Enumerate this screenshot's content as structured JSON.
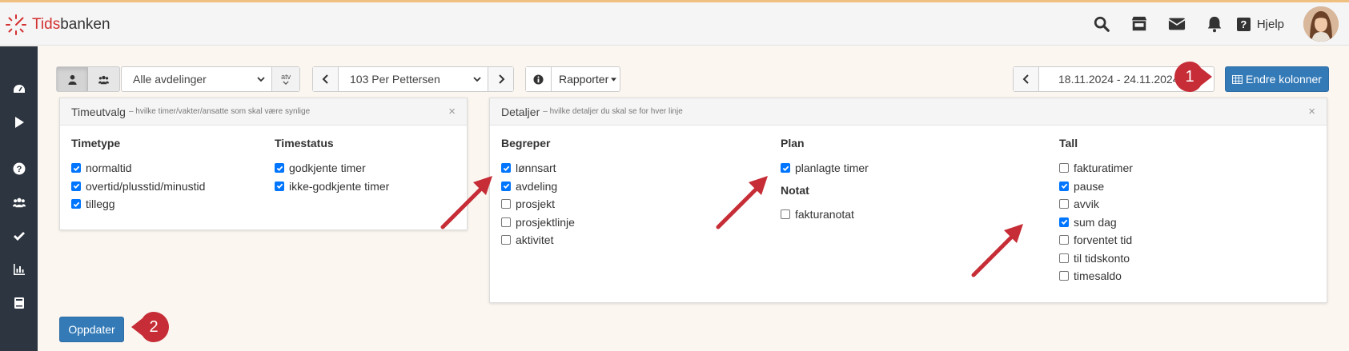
{
  "brand": {
    "logo_red": "Tids",
    "logo_dark": "banken"
  },
  "nav": {
    "icons": [
      "search-icon",
      "store-icon",
      "envelope-icon",
      "bell-icon"
    ],
    "help_label": "Hjelp"
  },
  "sidebar": {
    "icons": [
      "dashboard-icon",
      "play-icon",
      "question-icon",
      "users-icon",
      "check-icon",
      "bar-chart-icon",
      "book-icon"
    ]
  },
  "toolbar": {
    "department": "Alle avdelinger",
    "department_addon": "atv",
    "employee": "103 Per Pettersen",
    "reports_label": "Rapporter",
    "date_range": "18.11.2024 - 24.11.2024",
    "change_columns_label": "Endre kolonner"
  },
  "time_selection": {
    "title": "Timeutvalg",
    "subtitle": "– hvilke timer/vakter/ansatte som skal være synlige",
    "close": "×",
    "time_type": {
      "header": "Timetype",
      "items": [
        {
          "label": "normaltid",
          "checked": true
        },
        {
          "label": "overtid/plusstid/minustid",
          "checked": true
        },
        {
          "label": "tillegg",
          "checked": true
        }
      ]
    },
    "time_status": {
      "header": "Timestatus",
      "items": [
        {
          "label": "godkjente timer",
          "checked": true
        },
        {
          "label": "ikke-godkjente timer",
          "checked": true
        }
      ]
    }
  },
  "details": {
    "title": "Detaljer",
    "subtitle": "– hvilke detaljer du skal se for hver linje",
    "close": "×",
    "terms": {
      "header": "Begreper",
      "items": [
        {
          "label": "lønnsart",
          "checked": true
        },
        {
          "label": "avdeling",
          "checked": true
        },
        {
          "label": "prosjekt",
          "checked": false
        },
        {
          "label": "prosjektlinje",
          "checked": false
        },
        {
          "label": "aktivitet",
          "checked": false
        }
      ]
    },
    "plan": {
      "header": "Plan",
      "items": [
        {
          "label": "planlagte timer",
          "checked": true
        }
      ]
    },
    "note": {
      "header": "Notat",
      "items": [
        {
          "label": "fakturanotat",
          "checked": false
        }
      ]
    },
    "numbers": {
      "header": "Tall",
      "items": [
        {
          "label": "fakturatimer",
          "checked": false
        },
        {
          "label": "pause",
          "checked": true
        },
        {
          "label": "avvik",
          "checked": false
        },
        {
          "label": "sum dag",
          "checked": true
        },
        {
          "label": "forventet tid",
          "checked": false
        },
        {
          "label": "til tidskonto",
          "checked": false
        },
        {
          "label": "timesaldo",
          "checked": false
        }
      ]
    }
  },
  "update_label": "Oppdater",
  "callouts": {
    "first": "1",
    "second": "2"
  },
  "colors": {
    "primary": "#337ab7",
    "callout": "#c62d36",
    "checkbox": "#0075ff",
    "sidebar": "#2c3540"
  }
}
